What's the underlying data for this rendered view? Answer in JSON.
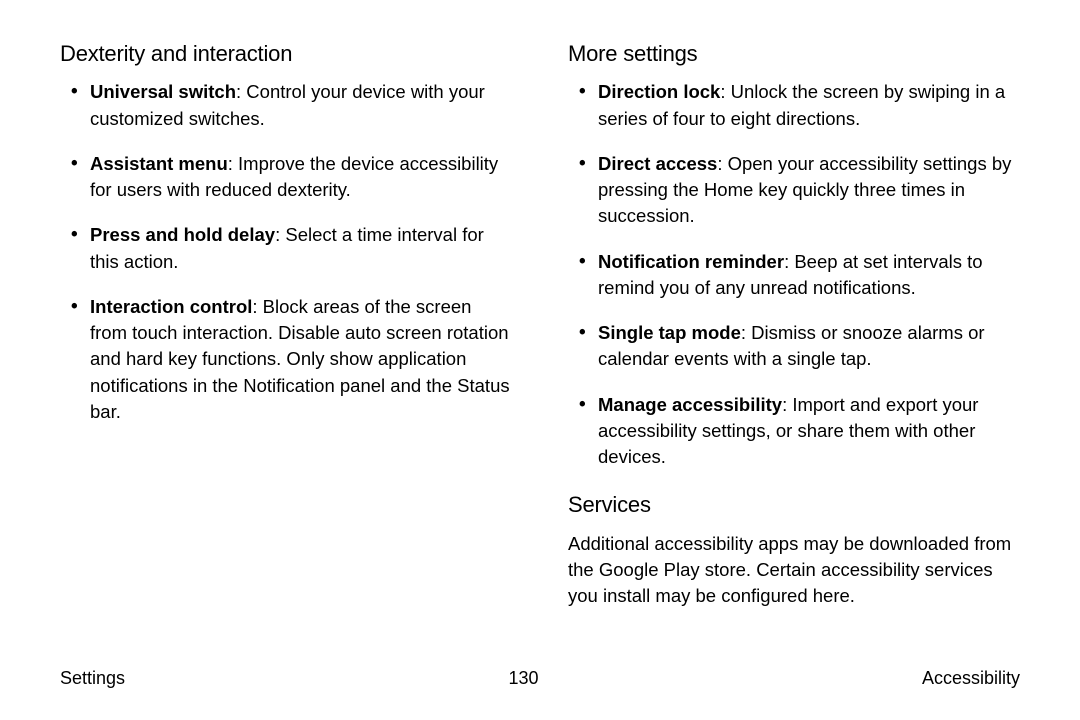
{
  "left": {
    "heading": "Dexterity and interaction",
    "items": [
      {
        "term": "Universal switch",
        "desc": ": Control your device with your customized switches."
      },
      {
        "term": "Assistant menu",
        "desc": ": Improve the device accessibility for users with reduced dexterity."
      },
      {
        "term": "Press and hold delay",
        "desc": ": Select a time interval for this action."
      },
      {
        "term": "Interaction control",
        "desc": ": Block areas of the screen from touch interaction. Disable auto screen rotation and hard key functions. Only show application notifications in the Notification panel and the Status bar."
      }
    ]
  },
  "right": {
    "heading1": "More settings",
    "items": [
      {
        "term": "Direction lock",
        "desc": ": Unlock the screen by swiping in a series of four to eight directions."
      },
      {
        "term": "Direct access",
        "desc": ": Open your accessibility settings by pressing the Home key quickly three times in succession."
      },
      {
        "term": "Notification reminder",
        "desc": ": Beep at set intervals to remind you of any unread notifications."
      },
      {
        "term": "Single tap mode",
        "desc": ": Dismiss or snooze alarms or calendar events with a single tap."
      },
      {
        "term": "Manage accessibility",
        "desc": ": Import and export your accessibility settings, or share them with other devices."
      }
    ],
    "heading2": "Services",
    "services_desc": "Additional accessibility apps may be downloaded from the Google Play store. Certain accessibility services you install may be configured here."
  },
  "footer": {
    "left": "Settings",
    "center": "130",
    "right": "Accessibility"
  }
}
